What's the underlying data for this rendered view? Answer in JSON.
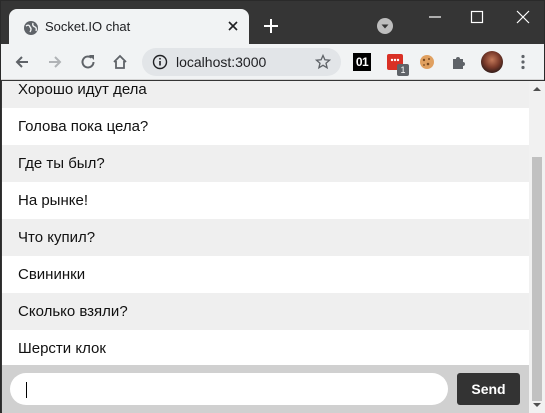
{
  "browser": {
    "tab_title": "Socket.IO chat",
    "url": "localhost:3000",
    "extension_01_label": "01",
    "extension_badge_count": "1",
    "icons": {
      "favicon": "globe-icon",
      "tab_close": "close-icon",
      "new_tab": "plus-icon",
      "tab_search": "chevron-down-icon",
      "minimize": "minimize-icon",
      "maximize": "maximize-icon",
      "close": "close-icon",
      "back": "arrow-left-icon",
      "forward": "arrow-right-icon",
      "reload": "reload-icon",
      "home": "home-icon",
      "site_info": "info-icon",
      "bookmark": "star-icon",
      "extensions": "puzzle-icon",
      "menu": "kebab-menu-icon",
      "cookie": "cookie-icon"
    }
  },
  "chat": {
    "messages": [
      "Хорошо идут дела",
      "Голова пока цела?",
      "Где ты был?",
      "На рынке!",
      "Что купил?",
      "Свининки",
      "Сколько взяли?",
      "Шерсти клок"
    ],
    "input_value": "",
    "send_label": "Send"
  },
  "colors": {
    "send_button": "#333333",
    "form_background": "#d0d0d0",
    "odd_message": "#efefef"
  }
}
